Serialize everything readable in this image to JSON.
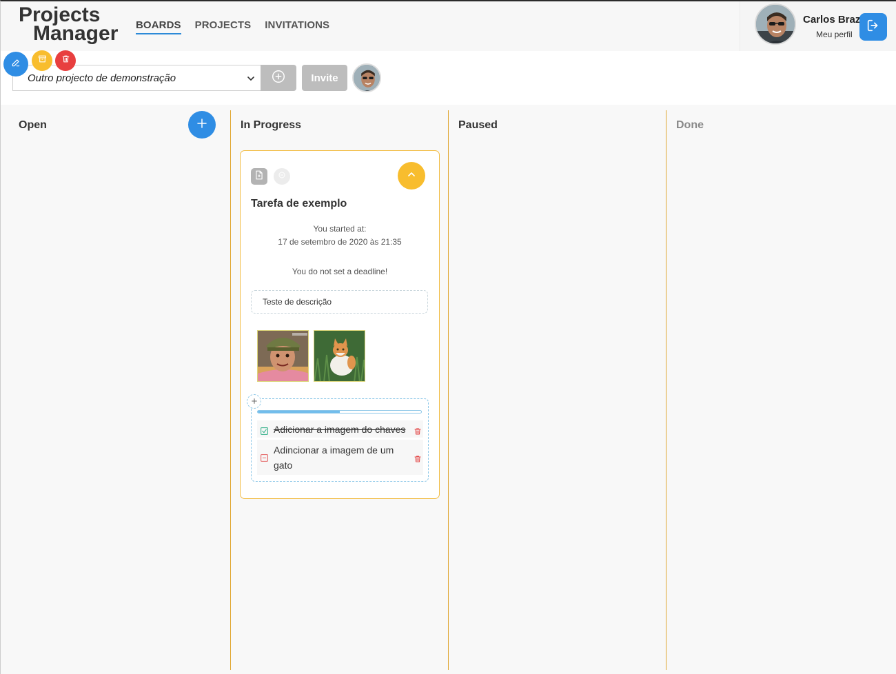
{
  "app": {
    "logo_line1": "Projects",
    "logo_line2": "Manager"
  },
  "nav": {
    "items": [
      {
        "label": "BOARDS",
        "active": true
      },
      {
        "label": "PROJECTS",
        "active": false
      },
      {
        "label": "INVITATIONS",
        "active": false
      }
    ]
  },
  "user": {
    "name": "Carlos Braz",
    "profile_link": "Meu perfil"
  },
  "project": {
    "selected": "Outro projecto de demonstração",
    "invite_label": "Invite"
  },
  "columns": [
    {
      "title": "Open"
    },
    {
      "title": "In Progress"
    },
    {
      "title": "Paused"
    },
    {
      "title": "Done"
    }
  ],
  "task": {
    "title": "Tarefa de exemplo",
    "started_label": "You started at:",
    "started_value": "17 de setembro de 2020 às 21:35",
    "deadline_text": "You do not set a deadline!",
    "description": "Teste de descrição",
    "checklist": {
      "progress": 0.5,
      "items": [
        {
          "text": "Adicionar a imagem do chaves",
          "done": true
        },
        {
          "text": "Adincionar a imagem de um gato",
          "done": false
        }
      ]
    }
  },
  "colors": {
    "primary": "#2f8de4",
    "warning": "#f8bd2e",
    "danger": "#e83f3f",
    "column_divider": "#e0a630"
  }
}
